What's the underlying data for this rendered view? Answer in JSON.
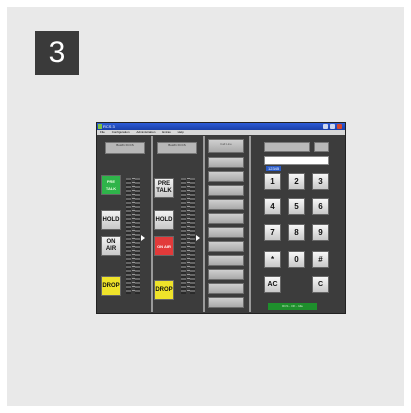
{
  "step_number": "3",
  "window": {
    "title": "RCS 3",
    "menu": [
      "File",
      "Configuration",
      "Administration",
      "Extras",
      "Help"
    ]
  },
  "channels": [
    {
      "line_label": "Bus#1 FCCS",
      "pretalk_label": "PRE TALK",
      "hold_label": "HOLD",
      "onair_label": "ON AIR",
      "drop_label": "DROP",
      "active": "pretalk"
    },
    {
      "line_label": "Bus#1 FCCS",
      "pretalk_label": "PRE TALK",
      "hold_label": "HOLD",
      "onair_label": "ON AIR",
      "drop_label": "DROP",
      "active": "onair"
    }
  ],
  "speed_dial": {
    "header": "Call Line",
    "slots": [
      "",
      "",
      "",
      "",
      "",
      "",
      "",
      "",
      "",
      "",
      "",
      ""
    ]
  },
  "dialpad": {
    "number_value": "12345",
    "keys": [
      "1",
      "2",
      "3",
      "4",
      "5",
      "6",
      "7",
      "8",
      "9",
      "*",
      "0",
      "#"
    ],
    "ac_label": "AC",
    "c_label": "C",
    "status_text": "RCS - OK - Idle"
  },
  "colors": {
    "pretalk_active": "#2fb44a",
    "onair_active": "#e23a3a",
    "drop": "#efe32a",
    "status": "#1e8f2c"
  }
}
